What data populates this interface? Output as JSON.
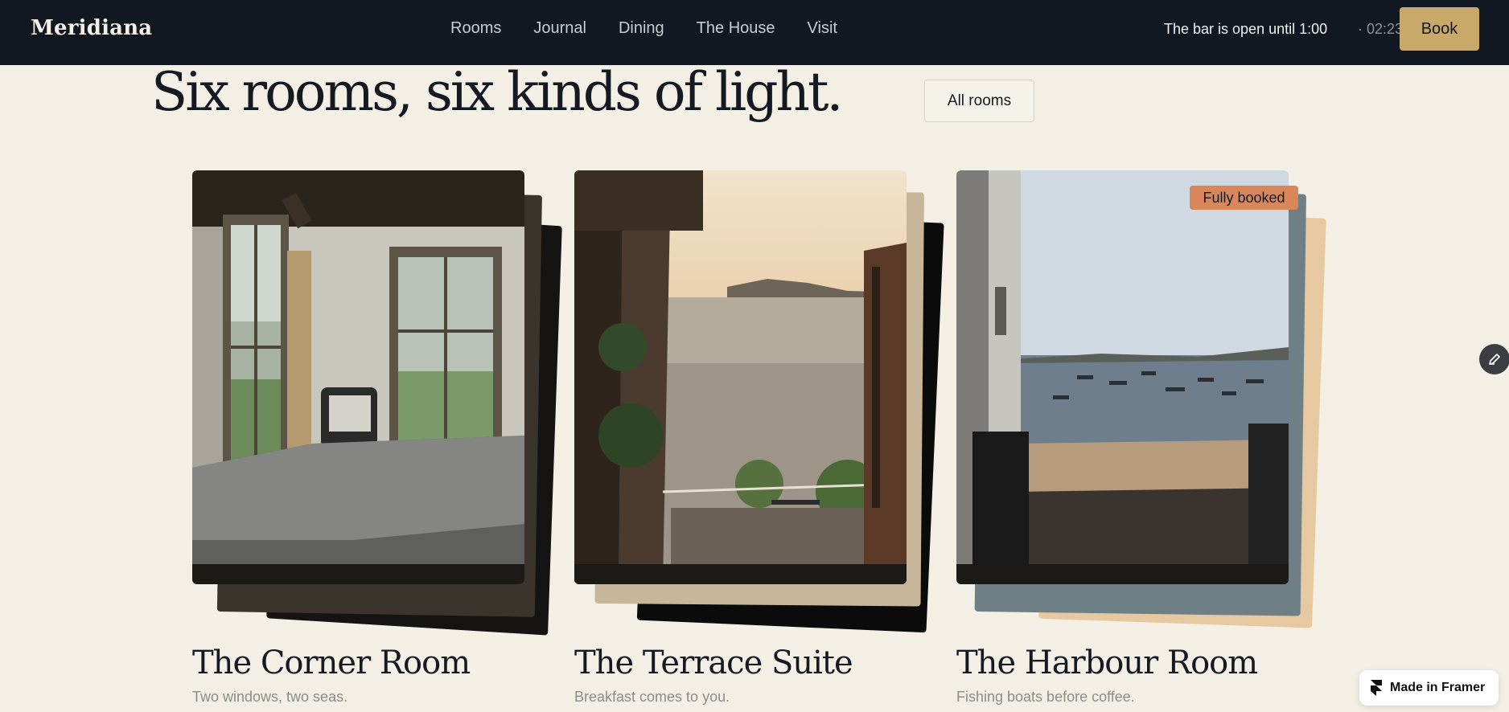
{
  "brand": {
    "logo": "Meridiana"
  },
  "nav": {
    "links": [
      "Rooms",
      "Journal",
      "Dining",
      "The House",
      "Visit"
    ],
    "bar_status": "The bar is open until 1:00",
    "bar_time": "· 02:23",
    "book_label": "Book"
  },
  "section": {
    "heading": "Six rooms, six kinds of light.",
    "all_rooms_label": "All rooms"
  },
  "rooms": [
    {
      "title": "The Corner Room",
      "subtitle": "Two windows, two seas.",
      "badge": ""
    },
    {
      "title": "The Terrace Suite",
      "subtitle": "Breakfast comes to you.",
      "badge": ""
    },
    {
      "title": "The Harbour Room",
      "subtitle": "Fishing boats before coffee.",
      "badge": "Fully booked"
    }
  ],
  "framer_badge": {
    "label": "Made in Framer"
  },
  "colors": {
    "nav_bg": "#121822",
    "page_bg": "#f3efe5",
    "accent": "#c9a96a",
    "badge": "#d9865b"
  },
  "icons": {
    "edit": "pencil-icon",
    "framer": "framer-logo-icon"
  }
}
